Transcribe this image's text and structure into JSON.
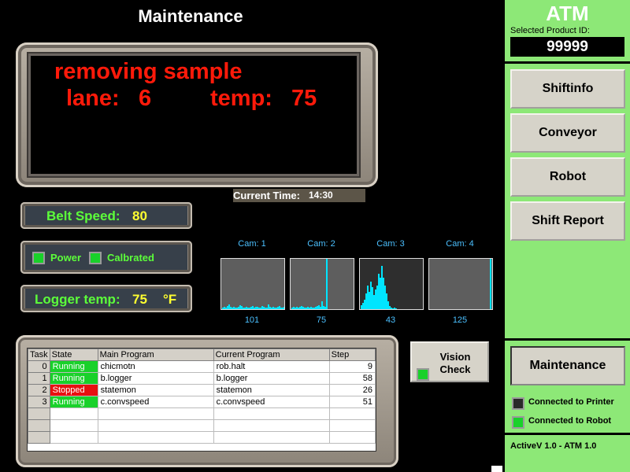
{
  "header": {
    "title": "Maintenance"
  },
  "display": {
    "line1": "removing sample",
    "lane_label": "lane:",
    "lane_value": "6",
    "temp_label": "temp:",
    "temp_value": "75"
  },
  "current_time": {
    "label": "Current Time:",
    "value": "14:30"
  },
  "belt": {
    "label": "Belt Speed:",
    "value": "80"
  },
  "indicators": {
    "power_label": "Power",
    "calibrated_label": "Calbrated"
  },
  "logger": {
    "label": "Logger temp:",
    "value": "75",
    "unit": "°F"
  },
  "cameras": [
    {
      "label": "Cam: 1",
      "value": "101"
    },
    {
      "label": "Cam: 2",
      "value": "75"
    },
    {
      "label": "Cam: 3",
      "value": "43"
    },
    {
      "label": "Cam: 4",
      "value": "125"
    }
  ],
  "table": {
    "headers": [
      "Task",
      "State",
      "Main Program",
      "Current Program",
      "Step"
    ],
    "rows": [
      {
        "task": "0",
        "state": "Running",
        "main": "chicmotn",
        "current": "rob.halt",
        "step": "9"
      },
      {
        "task": "1",
        "state": "Running",
        "main": "b.logger",
        "current": "b.logger",
        "step": "58"
      },
      {
        "task": "2",
        "state": "Stopped",
        "main": "statemon",
        "current": "statemon",
        "step": "26"
      },
      {
        "task": "3",
        "state": "Running",
        "main": "c.convspeed",
        "current": "c.convspeed",
        "step": "51"
      }
    ]
  },
  "vision_check": {
    "label": "Vision Check"
  },
  "sidebar": {
    "title": "ATM",
    "product_label": "Selected Product ID:",
    "product_id": "99999",
    "buttons": [
      "Shiftinfo",
      "Conveyor",
      "Robot",
      "Shift Report"
    ],
    "maintenance": "Maintenance",
    "printer_status": "Connected to Printer",
    "robot_status": "Connected to Robot",
    "version": "ActiveV 1.0 - ATM 1.0"
  },
  "colors": {
    "running": "#19d12a",
    "stopped": "#e81010",
    "sidebar": "#8de877",
    "display_text": "#ff1a0a"
  }
}
